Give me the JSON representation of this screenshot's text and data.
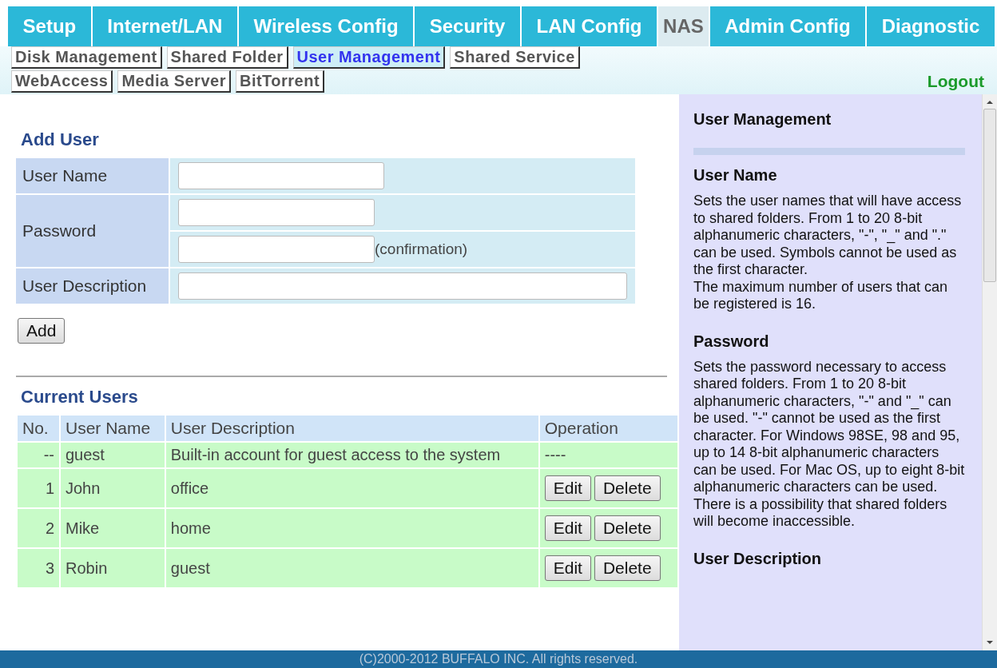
{
  "top_nav": [
    {
      "label": "Setup",
      "selected": false
    },
    {
      "label": "Internet/LAN",
      "selected": false
    },
    {
      "label": "Wireless Config",
      "selected": false
    },
    {
      "label": "Security",
      "selected": false
    },
    {
      "label": "LAN Config",
      "selected": false
    },
    {
      "label": "NAS",
      "selected": true
    },
    {
      "label": "Admin Config",
      "selected": false
    },
    {
      "label": "Diagnostic",
      "selected": false
    }
  ],
  "sub_nav": [
    {
      "label": "Disk Management",
      "selected": false
    },
    {
      "label": "Shared Folder",
      "selected": false
    },
    {
      "label": "User Management",
      "selected": true
    },
    {
      "label": "Shared Service",
      "selected": false
    },
    {
      "label": "WebAccess",
      "selected": false
    },
    {
      "label": "Media Server",
      "selected": false
    },
    {
      "label": "BitTorrent",
      "selected": false
    }
  ],
  "logout": "Logout",
  "add_user": {
    "title": "Add User",
    "user_name_label": "User Name",
    "password_label": "Password",
    "confirmation_note": "(confirmation)",
    "description_label": "User Description",
    "add_button": "Add"
  },
  "current_users": {
    "title": "Current Users",
    "columns": [
      "No.",
      "User Name",
      "User Description",
      "Operation"
    ],
    "rows": [
      {
        "kind": "builtin",
        "no": "--",
        "name": "guest",
        "description": "Built-in account for guest access to the system",
        "operation": "----"
      },
      {
        "kind": "user",
        "no": "1",
        "name": "John",
        "description": "office",
        "buttons": [
          "Edit",
          "Delete"
        ]
      },
      {
        "kind": "user",
        "no": "2",
        "name": "Mike",
        "description": "home",
        "buttons": [
          "Edit",
          "Delete"
        ]
      },
      {
        "kind": "user",
        "no": "3",
        "name": "Robin",
        "description": "guest",
        "buttons": [
          "Edit",
          "Delete"
        ]
      }
    ]
  },
  "help": {
    "title": "User Management",
    "sections": [
      {
        "heading": "User Name",
        "paragraphs": [
          "Sets the user names that will have access to shared folders. From 1 to 20 8-bit alphanumeric characters, \"-\", \"_\" and \".\" can be used. Symbols cannot be used as the first character.",
          "The maximum number of users that can be registered is 16."
        ]
      },
      {
        "heading": "Password",
        "paragraphs": [
          "Sets the password necessary to access shared folders. From 1 to 20 8-bit alphanumeric characters, \"-\" and \"_\" can be used. \"-\" cannot be used as the first character. For Windows 98SE, 98 and 95, up to 14 8-bit alphanumeric characters can be used. For Mac OS, up to eight 8-bit alphanumeric characters can be used. There is a possibility that shared folders will become inaccessible."
        ]
      },
      {
        "heading": "User Description"
      }
    ]
  },
  "footer": "(C)2000-2012 BUFFALO INC. All rights reserved."
}
